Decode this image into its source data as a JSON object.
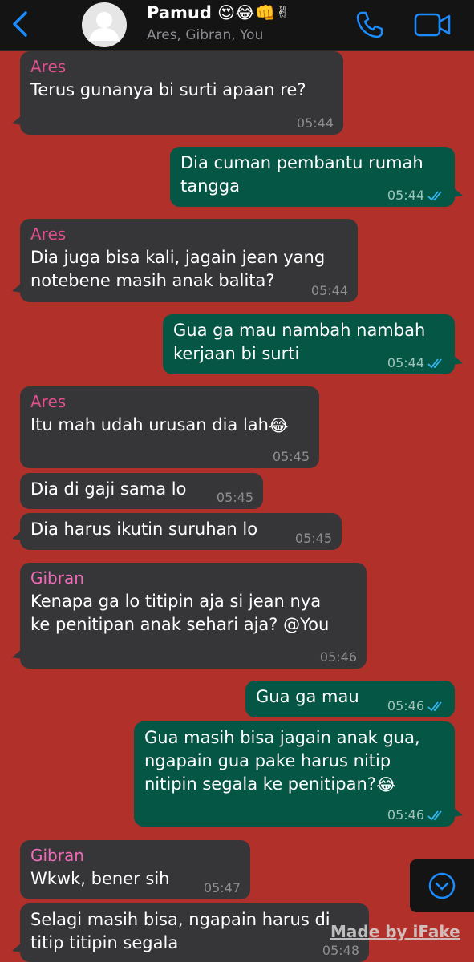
{
  "header": {
    "title": "Pamud 😍😂👊✌",
    "members": "Ares, Gibran, You",
    "accent_color": "#1a8cff",
    "back_icon": "chevron-left-icon",
    "call_icon": "phone-icon",
    "video_icon": "video-camera-icon"
  },
  "colors": {
    "background": "#b2302a",
    "incoming_bubble": "#363638",
    "outgoing_bubble": "#065646",
    "sender_ares": "#e0508f",
    "sender_gibran": "#f06ab8",
    "read_ticks": "#34b7f1"
  },
  "messages": [
    {
      "sender": "Ares",
      "text": "Terus gunanya bi surti apaan re?",
      "time": "05:44"
    },
    {
      "sender": "",
      "text": "Dia cuman pembantu rumah\ntangga",
      "time": "05:44",
      "read": true
    },
    {
      "sender": "Ares",
      "text": "Dia juga bisa kali, jagain jean yang\nnotebene masih anak balita?",
      "time": "05:44"
    },
    {
      "sender": "",
      "text": "Gua ga mau nambah nambah\nkerjaan bi surti",
      "time": "05:44",
      "read": true
    },
    {
      "sender": "Ares",
      "text": "Itu mah udah urusan dia lah",
      "emoji": "😂",
      "time": "05:45"
    },
    {
      "sender": "",
      "text": "Dia di gaji sama lo",
      "time": "05:45"
    },
    {
      "sender": "",
      "text": "Dia harus ikutin suruhan lo",
      "time": "05:45"
    },
    {
      "sender": "Gibran",
      "text": "Kenapa ga lo titipin aja si jean nya\nke penitipan anak sehari aja? @You",
      "time": "05:46"
    },
    {
      "sender": "",
      "text": "Gua ga mau",
      "time": "05:46",
      "read": true
    },
    {
      "sender": "",
      "text": "Gua masih bisa jagain anak gua,\nngapain gua pake harus nitip\nnitipin segala ke penitipan?",
      "emoji": "😂",
      "time": "05:46",
      "read": true
    },
    {
      "sender": "Gibran",
      "text": "Wkwk, bener sih",
      "time": "05:47"
    },
    {
      "sender": "",
      "text": "Selagi masih bisa, ngapain harus di\ntitip titipin segala",
      "time": "05:48"
    }
  ],
  "scroll_button_icon": "chevron-down-circle-icon",
  "watermark": "Made by iFake"
}
